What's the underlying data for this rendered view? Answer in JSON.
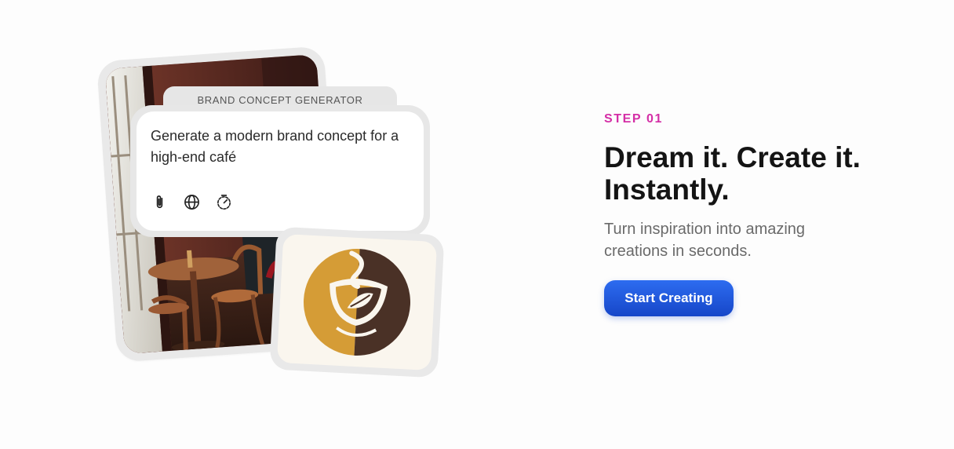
{
  "illustration": {
    "panel_title": "BRAND CONCEPT GENERATOR",
    "prompt_text": "Generate a modern brand concept for a high-end café",
    "toolbar_icons": [
      "paperclip-icon",
      "globe-icon",
      "timer-icon"
    ],
    "photo_subject": "cafe-interior-photo",
    "logo_subject": "coffee-cup-logo",
    "logo_colors": {
      "gold": "#d59c36",
      "brown": "#4a3126",
      "cream": "#faf6ee"
    }
  },
  "hero": {
    "step_label": "STEP 01",
    "headline_line1": "Dream it. Create it.",
    "headline_line2": "Instantly.",
    "subtext": "Turn inspiration into amazing creations in seconds.",
    "cta_label": "Start Creating"
  },
  "colors": {
    "accent_pink": "#d42ea6",
    "button_blue": "#1f56db",
    "headline": "#141414",
    "body_text": "#6a6a6a"
  }
}
